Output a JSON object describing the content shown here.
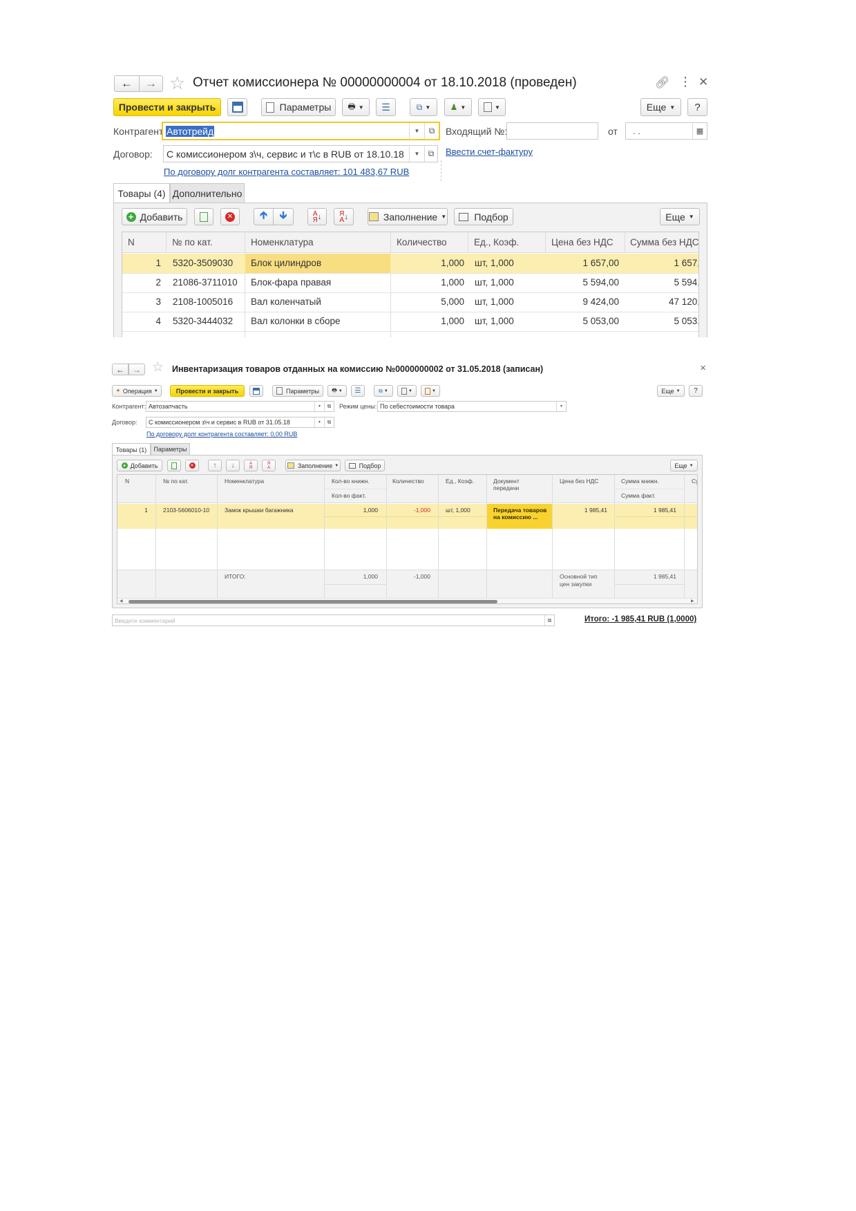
{
  "win1": {
    "title": "Отчет комиссионера № 00000000004 от 18.10.2018 (проведен)",
    "toolbar": {
      "post_close": "Провести и закрыть",
      "params": "Параметры",
      "more": "Еще",
      "help": "?"
    },
    "kontragent_label": "Контрагент:",
    "kontragent_value": "Автотрейд",
    "incoming_label": "Входящий №:",
    "incoming_value": "",
    "from_label": "от",
    "date_value": " .  . ",
    "dogovor_label": "Договор:",
    "dogovor_value": "С комиссионером з\\ч, сервис и т\\с в RUB от 18.10.18",
    "invoice_link": "Ввести счет-фактуру",
    "debt_link": "По договору долг контрагента составляет: 101 483,67 RUB",
    "tabs": [
      "Товары (4)",
      "Дополнительно"
    ],
    "table_toolbar": {
      "add": "Добавить",
      "fill": "Заполнение",
      "pick": "Подбор",
      "more": "Еще"
    },
    "columns": [
      "N",
      "№ по кат.",
      "Номенклатура",
      "Количество",
      "Ед., Коэф.",
      "Цена без НДС",
      "Сумма без НДС"
    ],
    "rows": [
      {
        "n": "1",
        "cat": "5320-3509030",
        "name": "Блок цилиндров",
        "qty": "1,000",
        "unit": "шт, 1,000",
        "price": "1 657,00",
        "sum": "1 657,"
      },
      {
        "n": "2",
        "cat": "21086-3711010",
        "name": "Блок-фара правая",
        "qty": "1,000",
        "unit": "шт, 1,000",
        "price": "5 594,00",
        "sum": "5 594,"
      },
      {
        "n": "3",
        "cat": "2108-1005016",
        "name": "Вал коленчатый",
        "qty": "5,000",
        "unit": "шт, 1,000",
        "price": "9 424,00",
        "sum": "47 120,"
      },
      {
        "n": "4",
        "cat": "5320-3444032",
        "name": "Вал колонки в сборе",
        "qty": "1,000",
        "unit": "шт, 1,000",
        "price": "5 053,00",
        "sum": "5 053,"
      }
    ]
  },
  "win2": {
    "title": "Инвентаризация товаров отданных на комиссию №0000000002 от 31.05.2018 (записан)",
    "toolbar": {
      "operation": "Операция",
      "post_close": "Провести и закрыть",
      "params": "Параметры",
      "more": "Еще",
      "help": "?"
    },
    "kontragent_label": "Контрагент:",
    "kontragent_value": "Автозапчасть",
    "price_mode_label": "Режим цены:",
    "price_mode_value": "По себестоимости товара",
    "dogovor_label": "Договор:",
    "dogovor_value": "С комиссионером з\\ч и сервис в RUB от 31.05.18",
    "debt_link": "По договору долг контрагента составляет: 0,00 RUB",
    "tabs": [
      "Товары (1)",
      "Параметры"
    ],
    "table_toolbar": {
      "add": "Добавить",
      "fill": "Заполнение",
      "pick": "Подбор",
      "more": "Еще"
    },
    "columns": {
      "n": "N",
      "cat": "№ по кат.",
      "name": "Номенклатура",
      "qty_book": "Кол-во книжн.",
      "qty_fact": "Кол-во факт.",
      "qty": "Количество",
      "unit": "Ед., Коэф.",
      "doc1": "Документ",
      "doc2": "передачи",
      "price": "Цена без НДС",
      "sum_book": "Сумма книжн.",
      "sum_fact": "Сумма факт.",
      "last": "Су"
    },
    "row": {
      "n": "1",
      "cat": "2103-5606010-10",
      "name": "Замок крышки багажника",
      "qty_book": "1,000",
      "qty": "-1,000",
      "unit": "шт, 1,000",
      "doc1": "Передача товаров",
      "doc2": "на комиссию ...",
      "price": "1 985,41",
      "sum_book": "1 985,41"
    },
    "footer": {
      "label": "ИТОГО:",
      "qty_book": "1,000",
      "qty": "-1,000",
      "price1": "Основной тип",
      "price2": "цен закупки",
      "sum_book": "1 985,41"
    },
    "comment_placeholder": "Введите комментарий",
    "total": "Итого: -1 985,41 RUB (1,0000)"
  }
}
